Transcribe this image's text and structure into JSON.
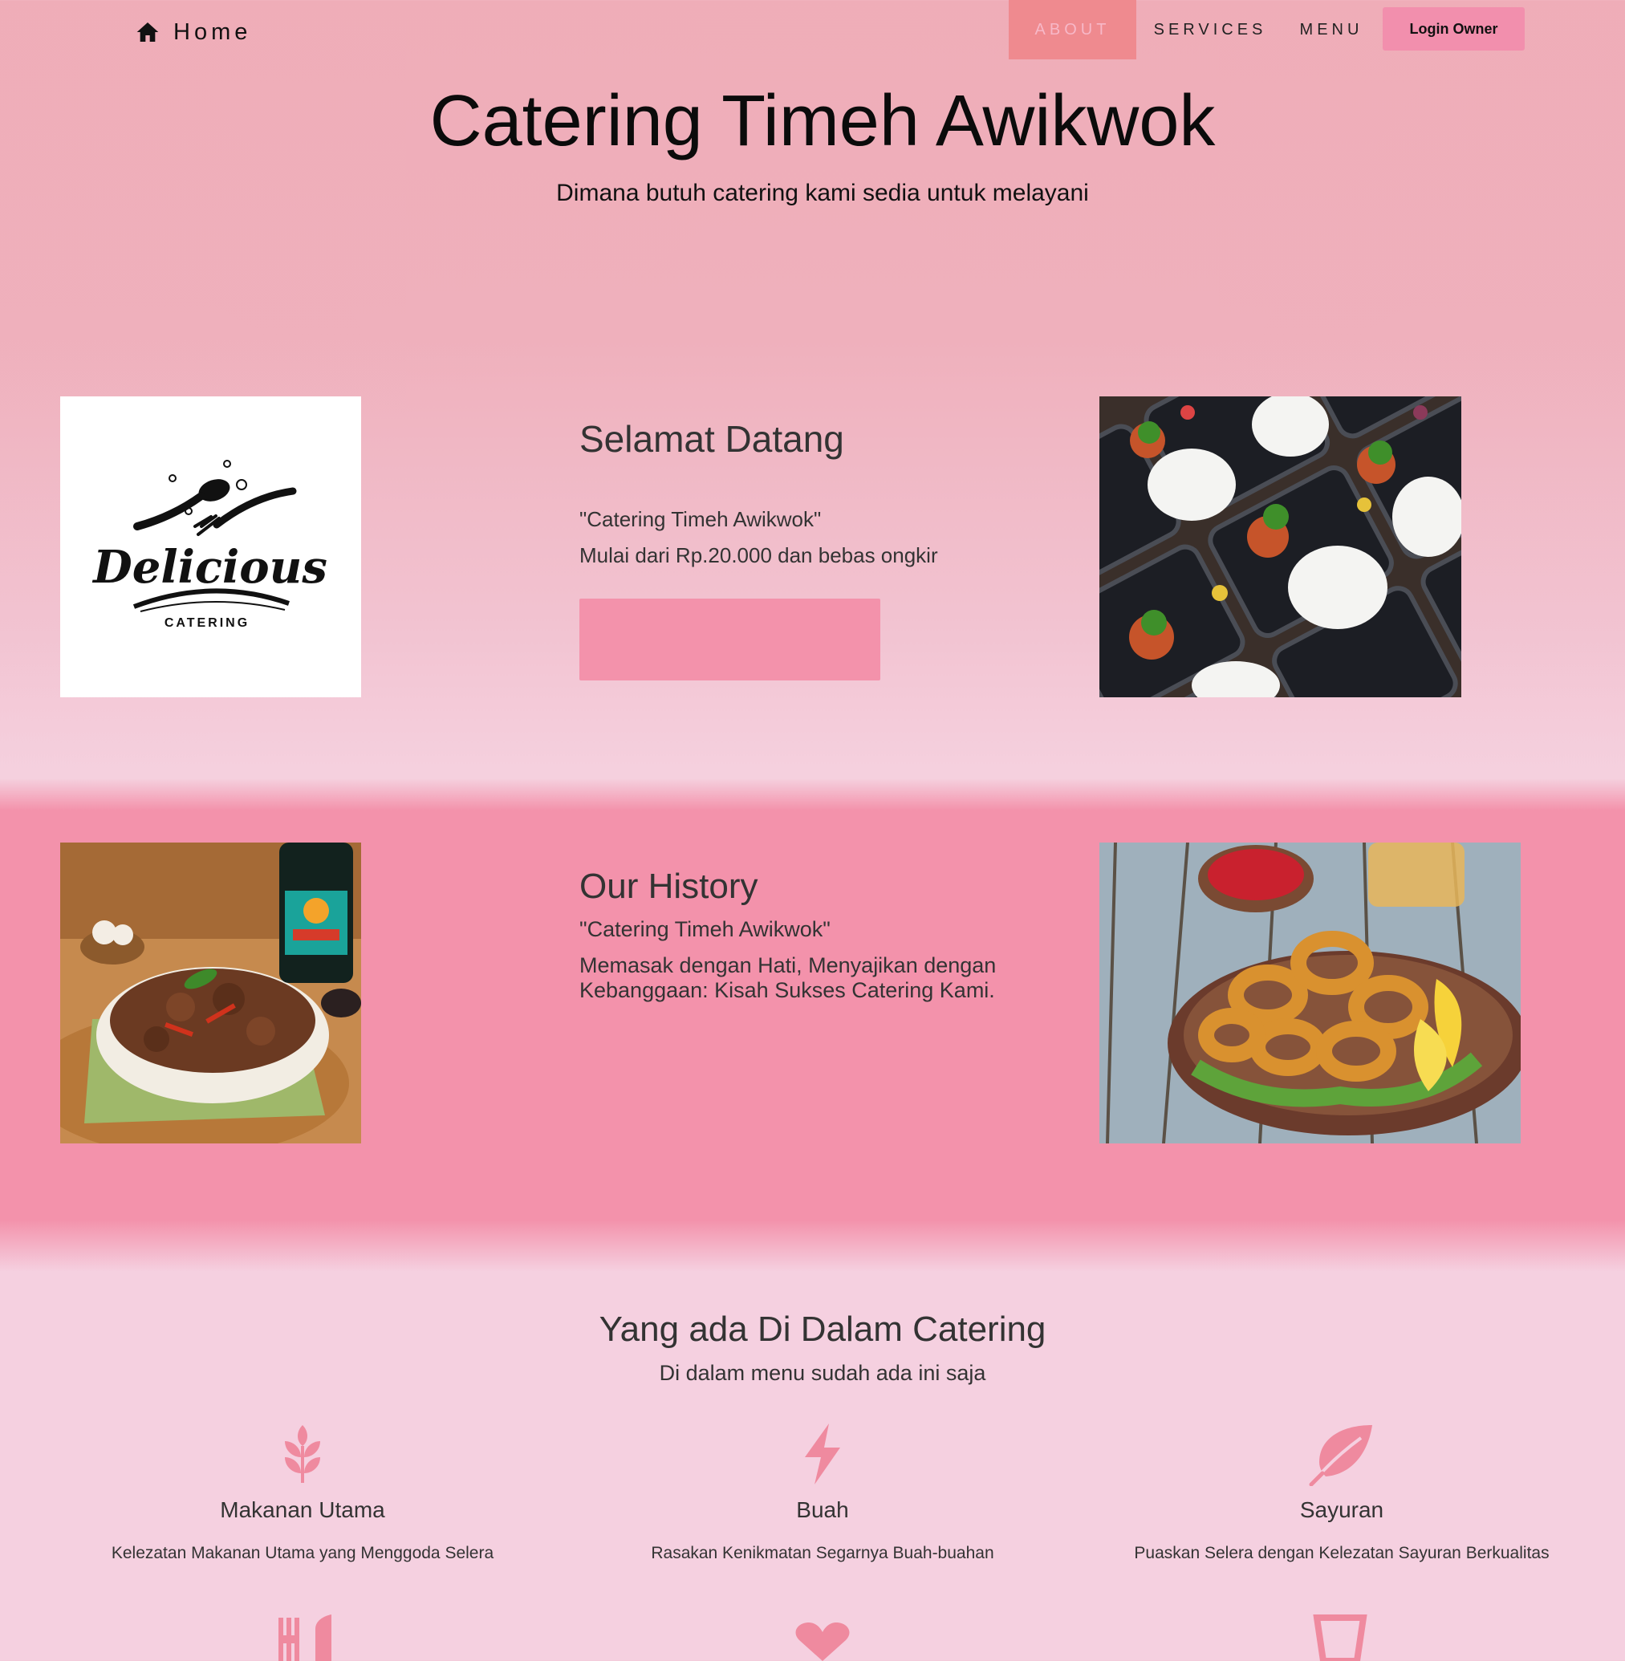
{
  "nav": {
    "home_label": "Home",
    "items": [
      {
        "label": "ABOUT"
      },
      {
        "label": "SERVICES"
      },
      {
        "label": "MENU"
      }
    ],
    "login_label": "Login Owner"
  },
  "hero": {
    "title": "Catering Timeh Awikwok",
    "subtitle": "Dimana butuh catering kami sedia untuk melayani"
  },
  "welcome": {
    "logo_text": "Delicious",
    "logo_subtext": "CATERING",
    "title": "Selamat Datang",
    "line1": "\"Catering Timeh Awikwok\"",
    "line2": "Mulai dari Rp.20.000 dan bebas ongkir"
  },
  "history": {
    "title": "Our History",
    "line1": "\"Catering Timeh Awikwok\"",
    "line2": "Memasak dengan Hati, Menyajikan dengan Kebanggaan: Kisah Sukses Catering Kami."
  },
  "services": {
    "title": "Yang ada Di Dalam Catering",
    "subtitle": "Di dalam menu sudah ada ini saja",
    "items": [
      {
        "icon": "wheat-icon",
        "name": "Makanan Utama",
        "desc": "Kelezatan Makanan Utama yang Menggoda Selera"
      },
      {
        "icon": "lightning-icon",
        "name": "Buah",
        "desc": "Rasakan Kenikmatan Segarnya Buah-buahan"
      },
      {
        "icon": "leaf-icon",
        "name": "Sayuran",
        "desc": "Puaskan Selera dengan Kelezatan Sayuran Berkualitas"
      }
    ]
  },
  "colors": {
    "accent": "#f392ab",
    "icon": "#ef8a9f",
    "nav_active": "#ef8a8f"
  }
}
